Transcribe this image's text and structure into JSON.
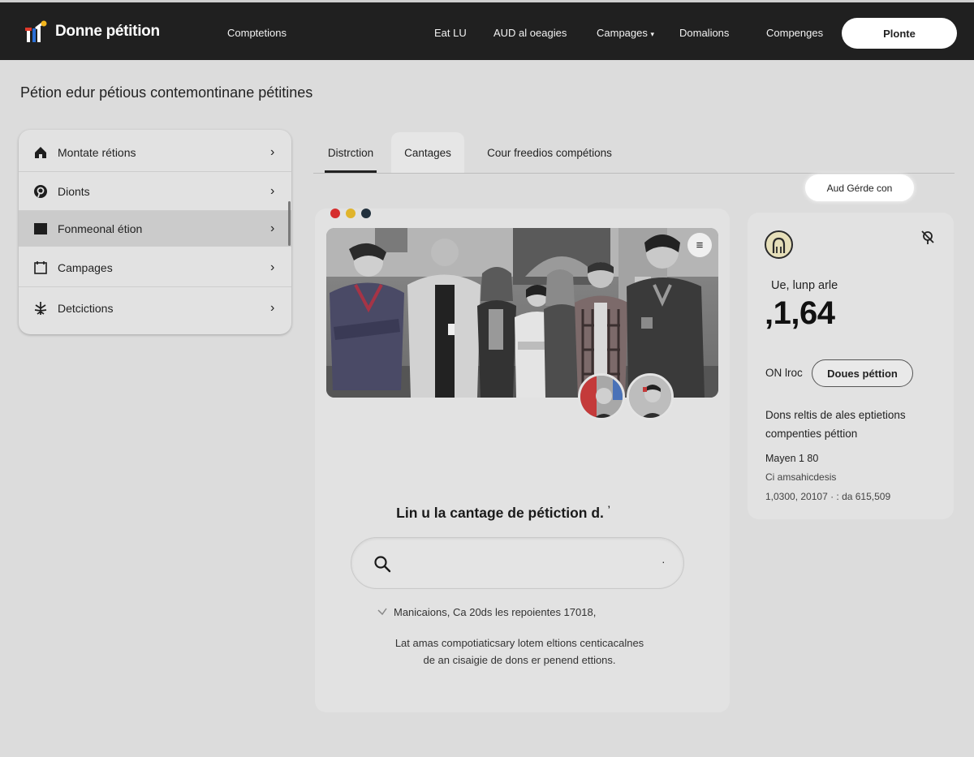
{
  "brand": {
    "name": "Donne pétition"
  },
  "nav": {
    "links": [
      "Comptetions",
      "Eat LU",
      "AUD al oeagies",
      "Campages",
      "Domalions",
      "Compenges"
    ],
    "cta_label": "Plonte"
  },
  "page": {
    "heading": "Pétion edur pétious contemontinane pétitines"
  },
  "sidebar": {
    "items": [
      {
        "label": "Montate rétions",
        "icon": "home-icon"
      },
      {
        "label": "Dionts",
        "icon": "pinterest-icon"
      },
      {
        "label": "Fonmeonal étion",
        "icon": "square-icon"
      },
      {
        "label": "Campages",
        "icon": "calendar-icon"
      },
      {
        "label": "Detcictions",
        "icon": "tree-icon"
      }
    ],
    "active_index": 2
  },
  "tabs": [
    "Distrction",
    "Cantages",
    "Cour freedios compétions"
  ],
  "small_pill": "Aud Gérde con",
  "center": {
    "window_dot_colors": [
      "#d52e2e",
      "#e0b42c",
      "#22313d"
    ],
    "heading": "Lin u la cantage de pétiction d.",
    "heading_mark": "’",
    "search_dot": "·",
    "check_text": "Manicaions, Ca 20ds les repoientes 17018,",
    "check_icon": "chevron-check-icon",
    "desc_line1": "Lat amas compotiaticsary lotem eltions centicacalnes",
    "desc_line2": "de an cisaigie de dons er penend ettions."
  },
  "right": {
    "sub": "Ue, lunp arle",
    "big_number": "‚1,64",
    "label": "ON lroc",
    "pill": "Doues péttion",
    "desc": "Dons reltis de ales eptietions compenties péttion",
    "meta1": "Mayen 1 80",
    "meta2": "Ci amsahicdesis",
    "meta3": "1,0300, 20107 · : da 615,509"
  }
}
